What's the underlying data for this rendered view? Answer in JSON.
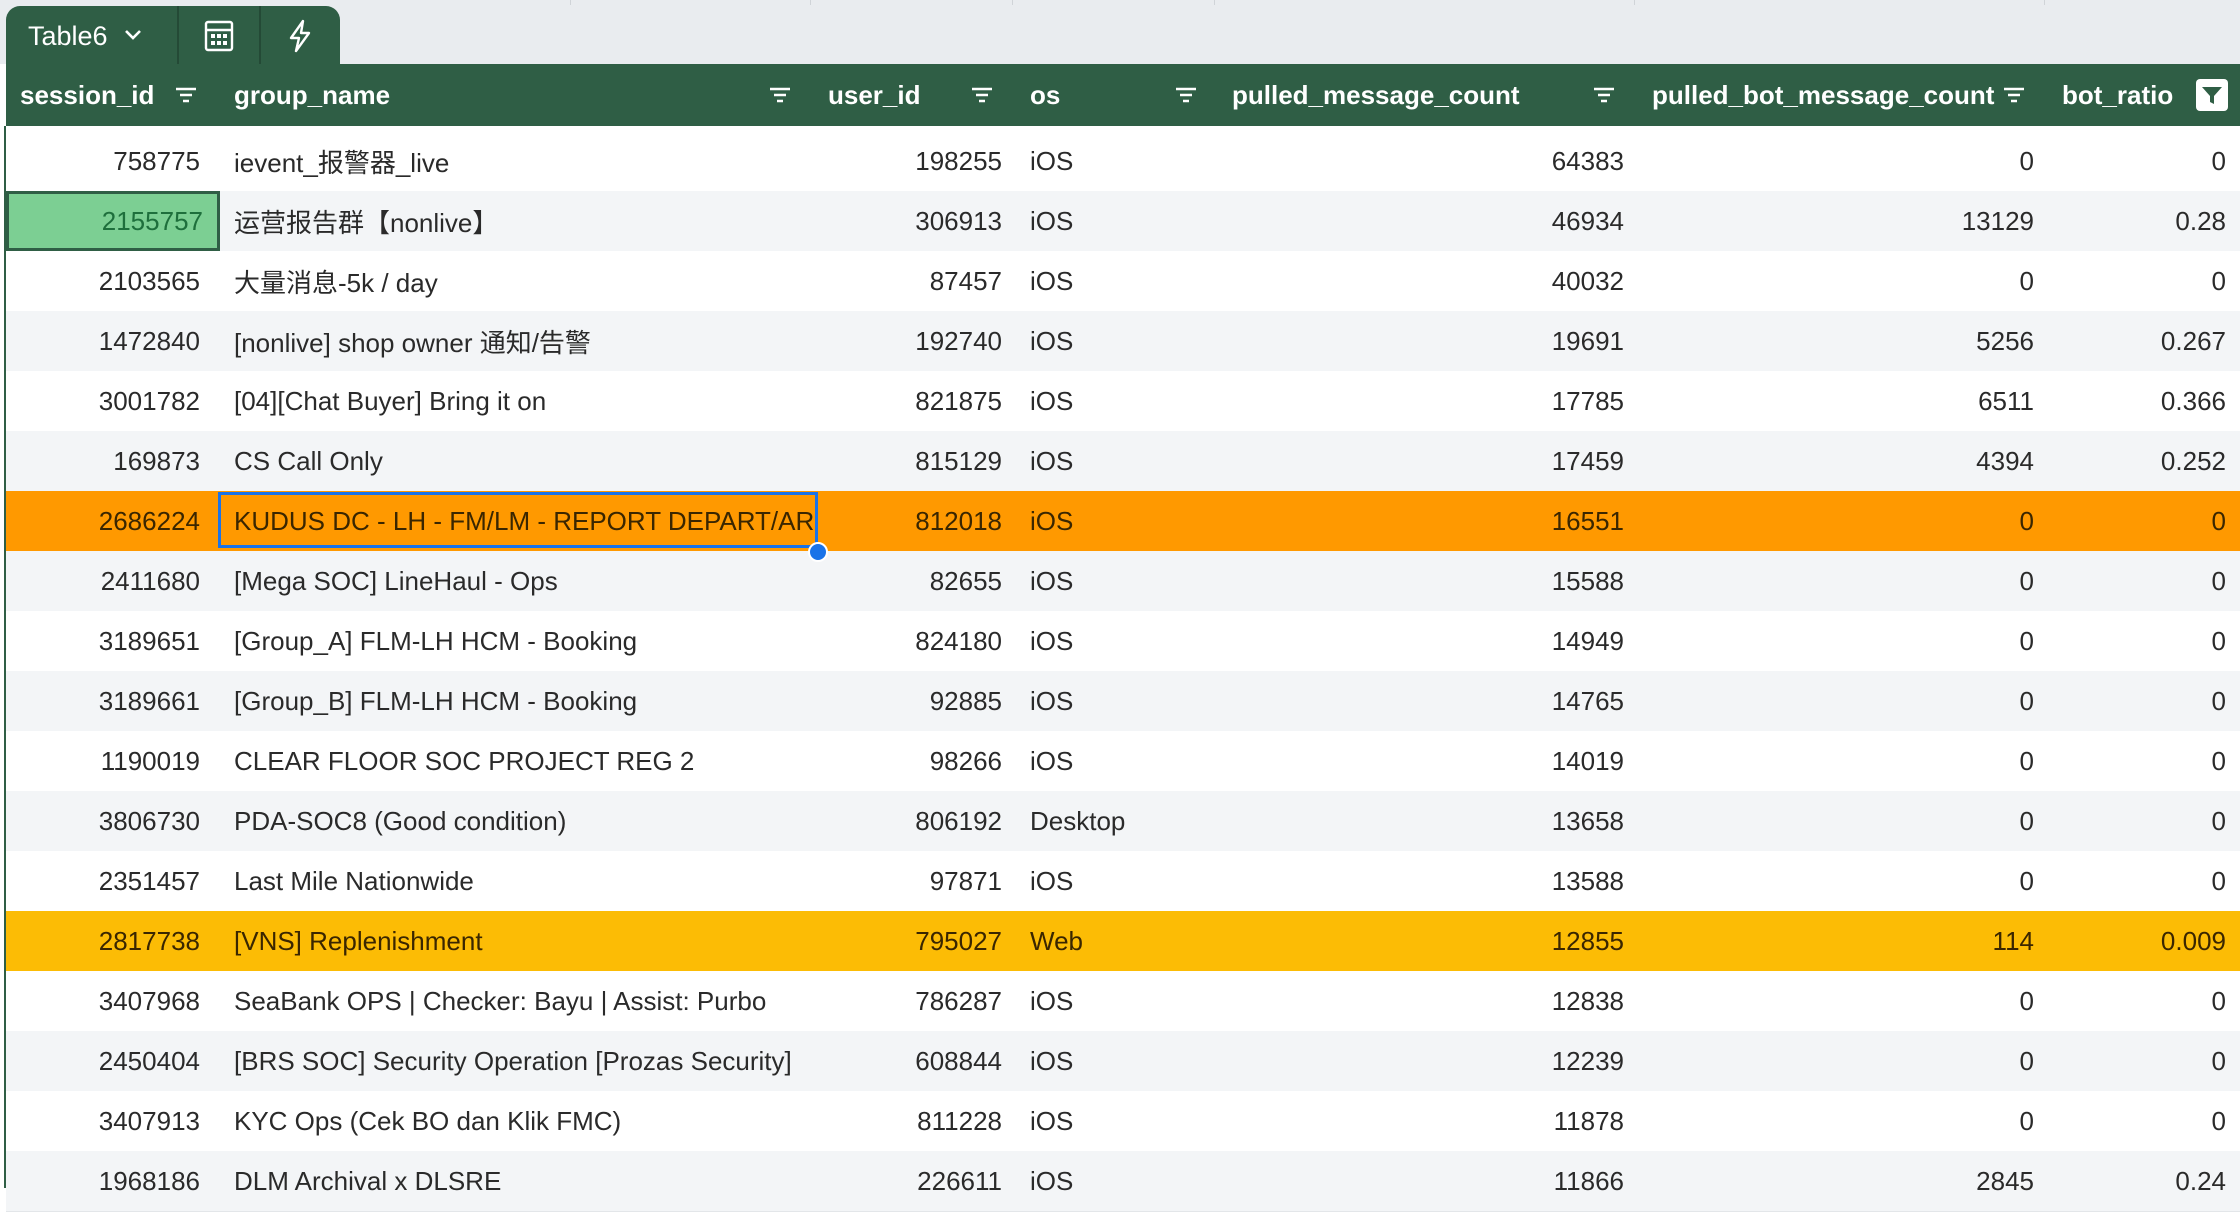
{
  "table": {
    "name": "Table6",
    "columns": [
      {
        "label": "session_id"
      },
      {
        "label": "group_name"
      },
      {
        "label": "user_id"
      },
      {
        "label": "os"
      },
      {
        "label": "pulled_message_count"
      },
      {
        "label": "pulled_bot_message_count"
      },
      {
        "label": "bot_ratio"
      }
    ],
    "rows": [
      [
        "758775",
        "ievent_报警器_live",
        "198255",
        "iOS",
        "64383",
        "0",
        "0"
      ],
      [
        "2155757",
        "运营报告群【nonlive】",
        "306913",
        "iOS",
        "46934",
        "13129",
        "0.28"
      ],
      [
        "2103565",
        "大量消息-5k / day",
        "87457",
        "iOS",
        "40032",
        "0",
        "0"
      ],
      [
        "1472840",
        "[nonlive] shop owner 通知/告警",
        "192740",
        "iOS",
        "19691",
        "5256",
        "0.267"
      ],
      [
        "3001782",
        "[04][Chat Buyer] Bring it on",
        "821875",
        "iOS",
        "17785",
        "6511",
        "0.366"
      ],
      [
        "169873",
        "CS Call Only",
        "815129",
        "iOS",
        "17459",
        "4394",
        "0.252"
      ],
      [
        "2686224",
        "KUDUS DC - LH - FM/LM - REPORT DEPART/ARRIVAL",
        "812018",
        "iOS",
        "16551",
        "0",
        "0"
      ],
      [
        "2411680",
        "[Mega SOC] LineHaul - Ops",
        "82655",
        "iOS",
        "15588",
        "0",
        "0"
      ],
      [
        "3189651",
        "[Group_A] FLM-LH HCM - Booking",
        "824180",
        "iOS",
        "14949",
        "0",
        "0"
      ],
      [
        "3189661",
        "[Group_B] FLM-LH HCM - Booking",
        "92885",
        "iOS",
        "14765",
        "0",
        "0"
      ],
      [
        "1190019",
        "CLEAR FLOOR SOC PROJECT REG 2",
        "98266",
        "iOS",
        "14019",
        "0",
        "0"
      ],
      [
        "3806730",
        "PDA-SOC8 (Good condition)",
        "806192",
        "Desktop",
        "13658",
        "0",
        "0"
      ],
      [
        "2351457",
        "Last Mile Nationwide",
        "97871",
        "iOS",
        "13588",
        "0",
        "0"
      ],
      [
        "2817738",
        "[VNS] Replenishment",
        "795027",
        "Web",
        "12855",
        "114",
        "0.009"
      ],
      [
        "3407968",
        "SeaBank OPS | Checker: Bayu | Assist: Purbo",
        "786287",
        "iOS",
        "12838",
        "0",
        "0"
      ],
      [
        "2450404",
        "[BRS SOC] Security Operation [Prozas Security]",
        "608844",
        "iOS",
        "12239",
        "0",
        "0"
      ],
      [
        "3407913",
        "KYC Ops (Cek BO dan Klik FMC)",
        "811228",
        "iOS",
        "11878",
        "0",
        "0"
      ],
      [
        "1968186",
        "DLM Archival x DLSRE",
        "226611",
        "iOS",
        "11866",
        "2845",
        "0.24"
      ]
    ],
    "row_highlights": {
      "6": "orange",
      "13": "amber"
    },
    "selected_cell": {
      "row": 1,
      "col": 0
    },
    "editing_cell": {
      "row": 6,
      "col": 1
    }
  },
  "colors": {
    "header_bg": "#2f5e45",
    "orange_row": "#ff9900",
    "amber_row": "#fcbc05",
    "selected_cell": "#7ccf93",
    "edit_border": "#1a73e8"
  },
  "icons": {
    "tab_dropdown": "chevron-down-icon",
    "tab_calc": "calculator-icon",
    "tab_action": "lightning-icon",
    "column_filter": "filter-icon",
    "column_filter_active": "filter-active-icon"
  }
}
